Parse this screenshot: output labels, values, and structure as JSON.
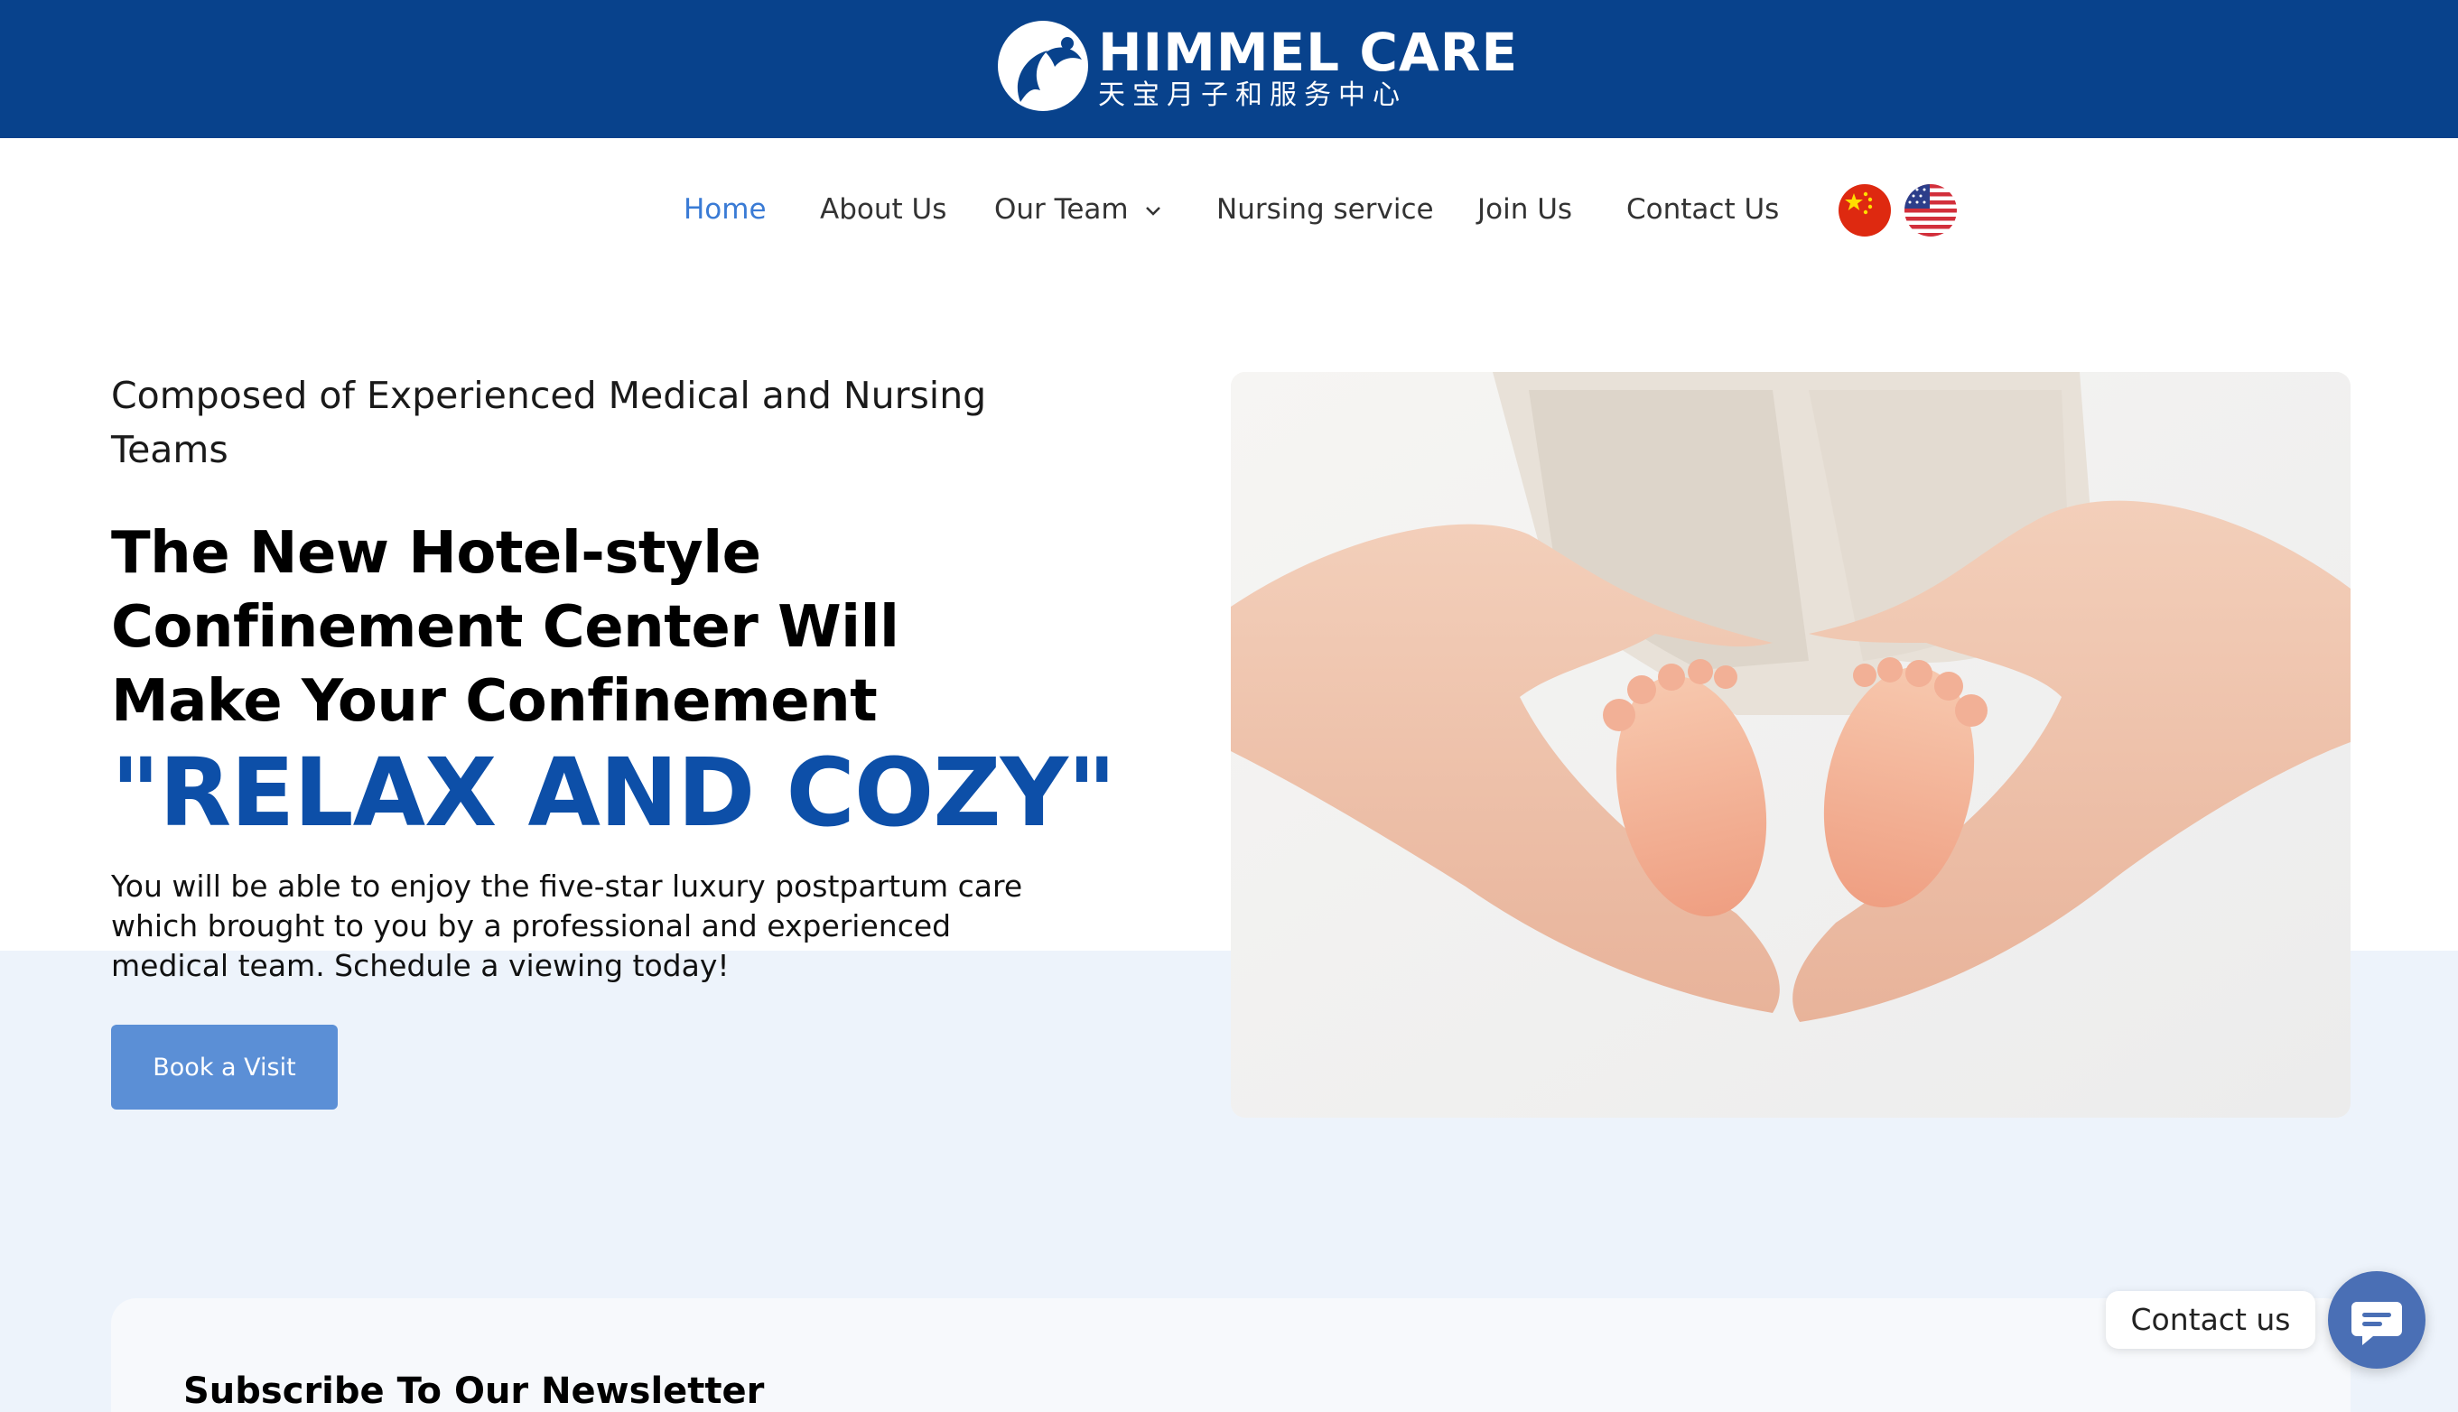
{
  "brand": {
    "name": "HIMMEL CARE",
    "subtitle": "天宝月子和服务中心"
  },
  "nav": {
    "items": [
      {
        "label": "Home",
        "active": true
      },
      {
        "label": "About Us"
      },
      {
        "label": "Our Team",
        "has_dropdown": true
      },
      {
        "label": "Nursing service"
      },
      {
        "label": "Join Us"
      },
      {
        "label": "Contact Us"
      }
    ],
    "languages": [
      "china-flag-icon",
      "usa-flag-icon"
    ]
  },
  "hero": {
    "eyebrow": "Composed of Experienced Medical and Nursing Teams",
    "headline": "The New Hotel-style Confinement Center Will Make Your Confinement",
    "highlight": "\"RELAX AND COZY\"",
    "description": "You will be able to enjoy the five-star luxury postpartum care which brought to you by a professional and experienced medical team. Schedule a viewing today!",
    "cta_label": "Book a Visit"
  },
  "newsletter": {
    "title": "Subscribe To Our Newsletter"
  },
  "chat_widget": {
    "label": "Contact us"
  },
  "colors": {
    "header_bg": "#08428c",
    "accent": "#0d4fa8",
    "nav_active": "#3a7bd5",
    "button_bg": "#5b8fd6",
    "lower_bg": "#edf3fb",
    "chat_button": "#4a6fb5"
  }
}
